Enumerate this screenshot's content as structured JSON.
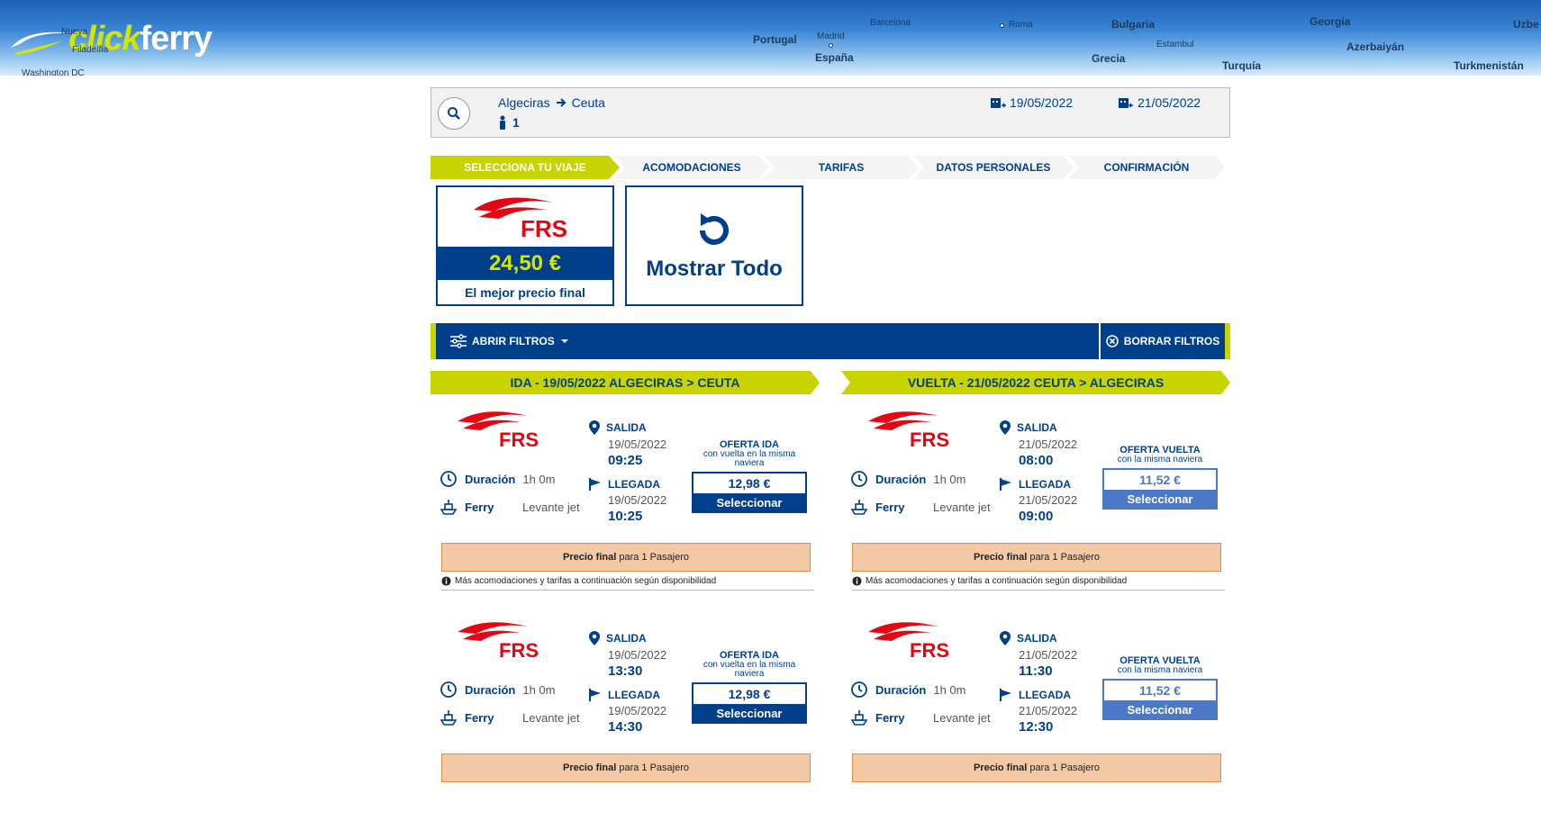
{
  "header": {
    "logo_part1": "click",
    "logo_part2": "ferry",
    "map_labels": [
      "Nueva",
      "Filadelfia",
      "Washington DC",
      "Portugal",
      "Madrid",
      "España",
      "Barcelona",
      "Roma",
      "Bulgaria",
      "Estambul",
      "Grecia",
      "Georgia",
      "Azerbaiyán",
      "Turquía",
      "Turkmenistán",
      "Uzbe"
    ]
  },
  "search": {
    "origin": "Algeciras",
    "destination": "Ceuta",
    "passengers": "1",
    "date_out": "19/05/2022",
    "date_back": "21/05/2022"
  },
  "steps": [
    "SELECCIONA TU VIAJE",
    "ACOMODACIONES",
    "TARIFAS",
    "DATOS PERSONALES",
    "CONFIRMACIÓN"
  ],
  "best_price": {
    "operator": "FRS",
    "price": "24,50 €",
    "label": "El mejor precio final"
  },
  "show_all": {
    "label": "Mostrar Todo"
  },
  "filters": {
    "open_label": "ABRIR FILTROS",
    "clear_label": "BORRAR FILTROS"
  },
  "outbound": {
    "title": "IDA - 19/05/2022 ALGECIRAS > CEUTA",
    "trips": [
      {
        "dur_label": "Duración",
        "dur_value": "1h 0m",
        "ship_label": "Ferry",
        "ship_name": "Levante jet",
        "dep_label": "SALIDA",
        "dep_date": "19/05/2022",
        "dep_time": "09:25",
        "arr_label": "LLEGADA",
        "arr_date": "19/05/2022",
        "arr_time": "10:25",
        "offer_title": "OFERTA IDA",
        "offer_sub": "con vuelta en la misma naviera",
        "price": "12,98 €",
        "select": "Seleccionar",
        "final_bold": "Precio final",
        "final_rest": "para 1 Pasajero",
        "info": "Más acomodaciones y tarifas a continuación según disponibilidad"
      },
      {
        "dur_label": "Duración",
        "dur_value": "1h 0m",
        "ship_label": "Ferry",
        "ship_name": "Levante jet",
        "dep_label": "SALIDA",
        "dep_date": "19/05/2022",
        "dep_time": "13:30",
        "arr_label": "LLEGADA",
        "arr_date": "19/05/2022",
        "arr_time": "14:30",
        "offer_title": "OFERTA IDA",
        "offer_sub": "con vuelta en la misma naviera",
        "price": "12,98 €",
        "select": "Seleccionar",
        "final_bold": "Precio final",
        "final_rest": "para 1 Pasajero"
      }
    ]
  },
  "return": {
    "title": "VUELTA - 21/05/2022 CEUTA > ALGECIRAS",
    "trips": [
      {
        "dur_label": "Duración",
        "dur_value": "1h 0m",
        "ship_label": "Ferry",
        "ship_name": "Levante jet",
        "dep_label": "SALIDA",
        "dep_date": "21/05/2022",
        "dep_time": "08:00",
        "arr_label": "LLEGADA",
        "arr_date": "21/05/2022",
        "arr_time": "09:00",
        "offer_title": "OFERTA VUELTA",
        "offer_sub": "con la misma naviera",
        "price": "11,52 €",
        "select": "Seleccionar",
        "final_bold": "Precio final",
        "final_rest": "para 1 Pasajero",
        "info": "Más acomodaciones y tarifas a continuación según disponibilidad"
      },
      {
        "dur_label": "Duración",
        "dur_value": "1h 0m",
        "ship_label": "Ferry",
        "ship_name": "Levante jet",
        "dep_label": "SALIDA",
        "dep_date": "21/05/2022",
        "dep_time": "11:30",
        "arr_label": "LLEGADA",
        "arr_date": "21/05/2022",
        "arr_time": "12:30",
        "offer_title": "OFERTA VUELTA",
        "offer_sub": "con la misma naviera",
        "price": "11,52 €",
        "select": "Seleccionar",
        "final_bold": "Precio final",
        "final_rest": "para 1 Pasajero"
      }
    ]
  },
  "colors": {
    "navy": "#003f8a",
    "lime": "#c8d300",
    "price_yellow": "#d4e600",
    "frs_red": "#e30613",
    "orange_box": "#f2c9a4"
  }
}
